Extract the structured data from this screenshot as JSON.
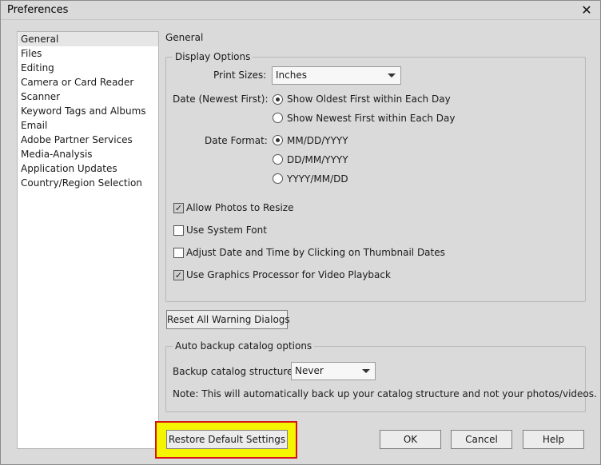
{
  "window": {
    "title": "Preferences",
    "close_glyph": "✕"
  },
  "sidebar": {
    "items": [
      {
        "label": "General",
        "selected": true
      },
      {
        "label": "Files"
      },
      {
        "label": "Editing"
      },
      {
        "label": "Camera or Card Reader"
      },
      {
        "label": "Scanner"
      },
      {
        "label": "Keyword Tags and Albums"
      },
      {
        "label": "Email"
      },
      {
        "label": "Adobe Partner Services"
      },
      {
        "label": "Media-Analysis"
      },
      {
        "label": "Application Updates"
      },
      {
        "label": "Country/Region Selection"
      }
    ]
  },
  "panel": {
    "title": "General",
    "display_options": {
      "legend": "Display Options",
      "print_sizes_label": "Print Sizes:",
      "print_sizes_value": "Inches",
      "date_order_label": "Date (Newest First):",
      "date_order_options": [
        "Show Oldest First within Each Day",
        "Show Newest First within Each Day"
      ],
      "date_order_selected": 0,
      "date_format_label": "Date Format:",
      "date_format_options": [
        "MM/DD/YYYY",
        "DD/MM/YYYY",
        "YYYY/MM/DD"
      ],
      "date_format_selected": 0,
      "checkboxes": [
        {
          "label": "Allow Photos to Resize",
          "checked": true
        },
        {
          "label": "Use System Font",
          "checked": false
        },
        {
          "label": "Adjust Date and Time by Clicking on Thumbnail Dates",
          "checked": false
        },
        {
          "label": "Use Graphics Processor for Video Playback",
          "checked": true
        }
      ]
    },
    "reset_warnings_button": "Reset All Warning Dialogs",
    "backup": {
      "legend": "Auto backup catalog options",
      "structure_label": "Backup catalog structure",
      "structure_value": "Never",
      "note": "Note: This will automatically back up your catalog structure and not your photos/videos."
    }
  },
  "footer": {
    "restore_button": "Restore Default Settings",
    "ok_button": "OK",
    "cancel_button": "Cancel",
    "help_button": "Help"
  },
  "colors": {
    "highlight_fill": "#f5f500",
    "highlight_border": "#d41515"
  },
  "icons": {
    "close": "close-icon",
    "dropdown": "chevron-down-icon",
    "check": "checkmark-icon"
  }
}
